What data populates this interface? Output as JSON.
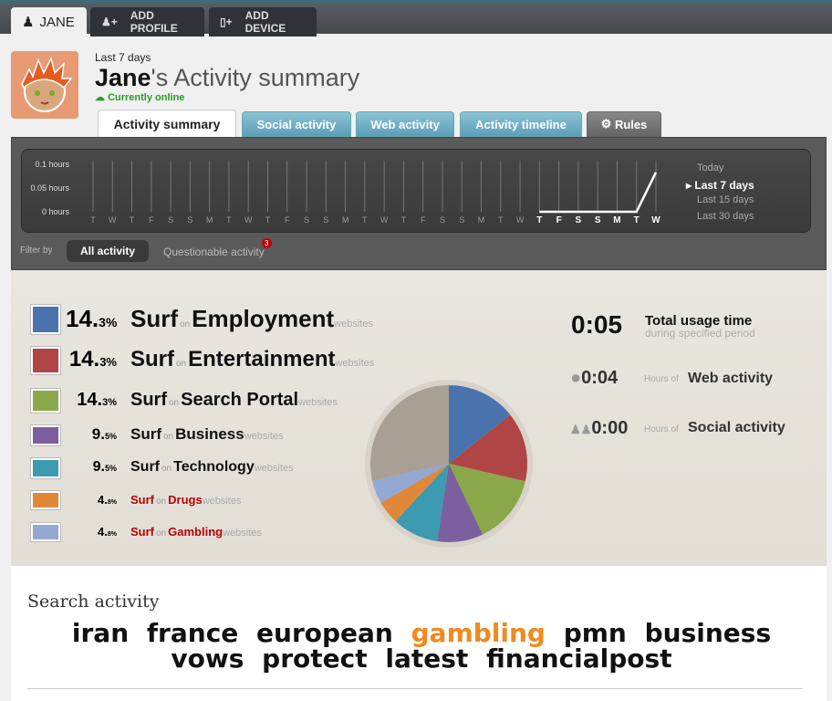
{
  "profile_tabs": [
    {
      "label": "JANE",
      "icon": "user-icon"
    },
    {
      "label": "ADD PROFILE",
      "icon": "add-user-icon"
    },
    {
      "label": "ADD DEVICE",
      "icon": "add-device-icon"
    }
  ],
  "header": {
    "period": "Last 7 days",
    "name": "Jane",
    "title_suffix": "'s Activity summary",
    "status": "Currently online"
  },
  "tabs": [
    "Activity summary",
    "Social activity",
    "Web activity",
    "Activity timeline",
    "Rules"
  ],
  "chart_data": {
    "type": "line",
    "yticks": [
      "0.1 hours",
      "0.05 hours",
      "0 hours"
    ],
    "ylim": [
      0,
      0.1
    ],
    "x": [
      "T",
      "W",
      "T",
      "F",
      "S",
      "S",
      "M",
      "T",
      "W",
      "T",
      "F",
      "S",
      "S",
      "M",
      "T",
      "W",
      "T",
      "F",
      "S",
      "S",
      "M",
      "T",
      "W",
      "T",
      "F",
      "S",
      "S",
      "M",
      "T",
      "W"
    ],
    "highlighted_from": 23,
    "values": [
      null,
      null,
      null,
      null,
      null,
      null,
      null,
      null,
      null,
      null,
      null,
      null,
      null,
      null,
      null,
      null,
      null,
      null,
      null,
      null,
      null,
      null,
      null,
      0,
      0,
      0,
      0,
      0,
      0,
      0.083
    ]
  },
  "ranges": [
    {
      "label": "Today",
      "selected": false
    },
    {
      "label": "Last 7 days",
      "selected": true
    },
    {
      "label": "Last 15 days",
      "selected": false
    },
    {
      "label": "Last 30 days",
      "selected": false
    }
  ],
  "filter": {
    "label": "Filter by",
    "all": "All activity",
    "questionable": "Questionable activity",
    "badge": "3"
  },
  "categories": [
    {
      "pct": "14.",
      "dec": "3%",
      "verb": "Surf",
      "cat": "Employment",
      "color": "#4a73ad",
      "value": 14.3,
      "size": 26,
      "flag": false
    },
    {
      "pct": "14.",
      "dec": "3%",
      "verb": "Surf",
      "cat": "Entertainment",
      "color": "#b04545",
      "value": 14.3,
      "size": 24,
      "flag": false
    },
    {
      "pct": "14.",
      "dec": "3%",
      "verb": "Surf",
      "cat": "Search Portal",
      "color": "#8aa84a",
      "value": 14.3,
      "size": 20,
      "flag": false
    },
    {
      "pct": "9.",
      "dec": "5%",
      "verb": "Surf",
      "cat": "Business",
      "color": "#7b5f9e",
      "value": 9.5,
      "size": 17,
      "flag": false
    },
    {
      "pct": "9.",
      "dec": "5%",
      "verb": "Surf",
      "cat": "Technology",
      "color": "#3c9bb0",
      "value": 9.5,
      "size": 16,
      "flag": false
    },
    {
      "pct": "4.",
      "dec": "8%",
      "verb": "Surf",
      "cat": "Drugs",
      "color": "#e0873a",
      "value": 4.8,
      "size": 13,
      "flag": true
    },
    {
      "pct": "4.",
      "dec": "8%",
      "verb": "Surf",
      "cat": "Gambling",
      "color": "#94a8d4",
      "value": 4.8,
      "size": 13,
      "flag": true
    }
  ],
  "pie_other": {
    "color": "#a8a095",
    "value": 28.5
  },
  "on_word": "on",
  "websites_word": "websites",
  "stats": {
    "total": "0:05",
    "total_label": "Total usage time",
    "total_sub": "during specified period",
    "web": "0:04",
    "web_label": "Web activity",
    "social": "0:00",
    "social_label": "Social activity",
    "hours_of": "Hours of"
  },
  "search": {
    "title": "Search activity",
    "terms": [
      {
        "t": "iran"
      },
      {
        "t": "france"
      },
      {
        "t": "european"
      },
      {
        "t": "gambling",
        "flag": true
      },
      {
        "t": "pmn"
      },
      {
        "t": "business"
      },
      {
        "t": "vows"
      },
      {
        "t": "protect"
      },
      {
        "t": "latest"
      },
      {
        "t": "financialpost"
      }
    ]
  }
}
